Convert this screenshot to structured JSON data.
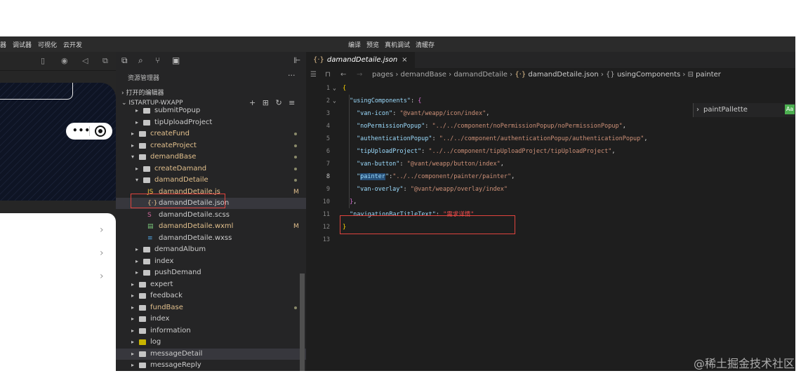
{
  "menu": {
    "left_items": [
      "器",
      "调试器",
      "可视化",
      "云开发"
    ],
    "center_items": [
      "编译",
      "预览",
      "真机调试",
      "清缓存"
    ]
  },
  "explorer": {
    "title": "资源管理器",
    "more": "···",
    "open_editors": "打开的编辑器",
    "project": "ISTARTUP-WXAPP",
    "tree": [
      {
        "label": "submitPopup",
        "kind": "folder"
      },
      {
        "label": "tipUploadProject",
        "kind": "folder"
      },
      {
        "label": "createFund",
        "kind": "folder",
        "dot": true
      },
      {
        "label": "createProject",
        "kind": "folder",
        "dot": true
      },
      {
        "label": "demandBase",
        "kind": "folder-open",
        "dot": true
      },
      {
        "label": "createDamand",
        "kind": "folder",
        "dot": true
      },
      {
        "label": "damandDetaile",
        "kind": "folder-open",
        "dot": true
      },
      {
        "label": "damandDetaile.js",
        "kind": "js",
        "badge": "M"
      },
      {
        "label": "damandDetaile.json",
        "kind": "json"
      },
      {
        "label": "damandDetaile.scss",
        "kind": "scss"
      },
      {
        "label": "damandDetaile.wxml",
        "kind": "wxml",
        "badge": "M"
      },
      {
        "label": "damandDetaile.wxss",
        "kind": "wxss"
      },
      {
        "label": "demandAlbum",
        "kind": "folder"
      },
      {
        "label": "index",
        "kind": "folder"
      },
      {
        "label": "pushDemand",
        "kind": "folder"
      },
      {
        "label": "expert",
        "kind": "folder"
      },
      {
        "label": "feedback",
        "kind": "folder"
      },
      {
        "label": "fundBase",
        "kind": "folder",
        "dot": true
      },
      {
        "label": "index",
        "kind": "folder"
      },
      {
        "label": "information",
        "kind": "folder"
      },
      {
        "label": "log",
        "kind": "folder-log"
      },
      {
        "label": "messageDetail",
        "kind": "folder"
      },
      {
        "label": "messageReply",
        "kind": "folder"
      }
    ]
  },
  "editor": {
    "tab_label": "damandDetaile.json",
    "tab_close": "×",
    "breadcrumb": [
      "pages",
      "demandBase",
      "damandDetaile",
      "damandDetaile.json",
      "usingComponents",
      "painter"
    ],
    "find_value": "paintPallette",
    "find_option": "Aa",
    "lines": [
      {
        "n": "1",
        "parts": [
          [
            "b",
            "{"
          ]
        ]
      },
      {
        "n": "2",
        "parts": [
          [
            "k",
            "\"usingComponents\""
          ],
          [
            "p",
            ": "
          ],
          [
            "b2",
            "{"
          ]
        ]
      },
      {
        "n": "3",
        "parts": [
          [
            "k",
            "\"van-icon\""
          ],
          [
            "p",
            ": "
          ],
          [
            "s",
            "\"@vant/weapp/icon/index\""
          ],
          [
            "p",
            ","
          ]
        ]
      },
      {
        "n": "4",
        "parts": [
          [
            "k",
            "\"noPermissionPopup\""
          ],
          [
            "p",
            ": "
          ],
          [
            "s",
            "\"../../component/noPermissionPopup/noPermissionPopup\""
          ],
          [
            "p",
            ","
          ]
        ]
      },
      {
        "n": "5",
        "parts": [
          [
            "k",
            "\"authenticationPopup\""
          ],
          [
            "p",
            ": "
          ],
          [
            "s",
            "\"../../component/authenticationPopup/authenticationPopup\""
          ],
          [
            "p",
            ","
          ]
        ]
      },
      {
        "n": "6",
        "parts": [
          [
            "k",
            "\"tipUploadProject\""
          ],
          [
            "p",
            ": "
          ],
          [
            "s",
            "\"../../component/tipUploadProject/tipUploadProject\""
          ],
          [
            "p",
            ","
          ]
        ]
      },
      {
        "n": "7",
        "parts": [
          [
            "k",
            "\"van-button\""
          ],
          [
            "p",
            ": "
          ],
          [
            "s",
            "\"@vant/weapp/button/index\""
          ],
          [
            "p",
            ","
          ]
        ]
      },
      {
        "n": "8",
        "parts": [
          [
            "k",
            "\""
          ],
          [
            "kh",
            "painter"
          ],
          [
            "k",
            "\""
          ],
          [
            "p",
            ":"
          ],
          [
            "s",
            "\"../../component/painter/painter\""
          ],
          [
            "p",
            ","
          ]
        ]
      },
      {
        "n": "9",
        "parts": [
          [
            "k",
            "\"van-overlay\""
          ],
          [
            "p",
            ": "
          ],
          [
            "s",
            "\"@vant/weapp/overlay/index\""
          ]
        ]
      },
      {
        "n": "10",
        "parts": [
          [
            "b2",
            "}"
          ],
          [
            "p",
            ","
          ]
        ]
      },
      {
        "n": "11",
        "parts": [
          [
            "k",
            "\"navigationBarTitleText\""
          ],
          [
            "p",
            ": "
          ],
          [
            "s-red",
            "\"需求详情\""
          ]
        ]
      },
      {
        "n": "12",
        "parts": [
          [
            "b",
            "}"
          ]
        ]
      },
      {
        "n": "13",
        "parts": []
      }
    ]
  },
  "watermark": "@稀土掘金技术社区"
}
